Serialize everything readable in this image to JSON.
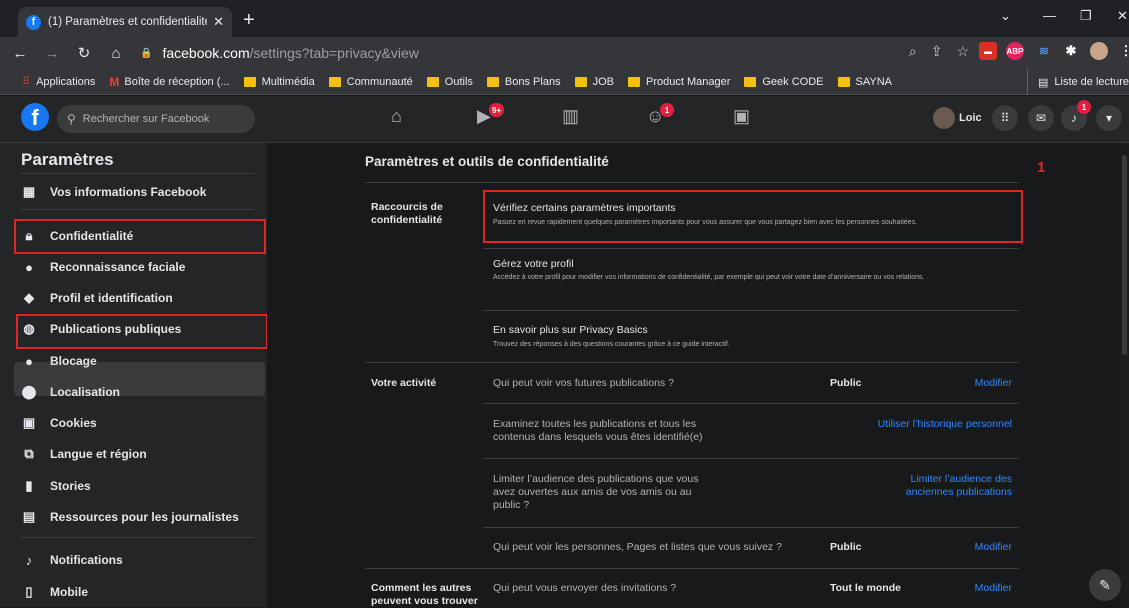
{
  "browser": {
    "tab_title": "(1) Paramètres et confidentialité |",
    "url_host": "facebook.com",
    "url_path": "/settings?tab=privacy&view",
    "bookmarks": [
      "Applications",
      "Boîte de réception (...",
      "Multimédia",
      "Communauté",
      "Outils",
      "Bons Plans",
      "JOB",
      "Product Manager",
      "Geek CODE",
      "SAYNA"
    ],
    "reading_list": "Liste de lecture",
    "ext_abp": "ABP"
  },
  "fb": {
    "search_placeholder": "Rechercher sur Facebook",
    "user_name": "Loic",
    "badge_watch": "9+",
    "badge_groups": "1",
    "badge_notif": "1"
  },
  "sidebar": {
    "title": "Paramètres",
    "items": [
      {
        "label": "Vos informations Facebook",
        "icon": "grid-icon"
      },
      {
        "label": "Confidentialité",
        "icon": "lock-icon"
      },
      {
        "label": "Reconnaissance faciale",
        "icon": "face-icon"
      },
      {
        "label": "Profil et identification",
        "icon": "tag-icon"
      },
      {
        "label": "Publications publiques",
        "icon": "globe-icon"
      },
      {
        "label": "Blocage",
        "icon": "block-user-icon"
      },
      {
        "label": "Localisation",
        "icon": "location-icon"
      },
      {
        "label": "Cookies",
        "icon": "cookie-icon"
      },
      {
        "label": "Langue et région",
        "icon": "language-icon"
      },
      {
        "label": "Stories",
        "icon": "stories-icon"
      },
      {
        "label": "Ressources pour les journalistes",
        "icon": "newspaper-icon"
      },
      {
        "label": "Notifications",
        "icon": "bell-icon"
      },
      {
        "label": "Mobile",
        "icon": "mobile-icon"
      }
    ]
  },
  "main": {
    "title": "Paramètres et outils de confidentialité",
    "annotation": "1",
    "shortcuts_label": "Raccourcis de confidentialité",
    "shortcuts": [
      {
        "title": "Vérifiez certains paramètres importants",
        "sub": "Passez en revue rapidement quelques paramètres importants pour vous assurer que vous partagez bien avec les personnes souhaitées."
      },
      {
        "title": "Gérez votre profil",
        "sub": "Accédez à votre profil pour modifier vos informations de confidentialité, par exemple qui peut voir votre date d’anniversaire ou vos relations."
      },
      {
        "title": "En savoir plus sur Privacy Basics",
        "sub": "Trouvez des réponses à des questions courantes grâce à ce guide interactif."
      }
    ],
    "activity_label": "Votre activité",
    "activity": [
      {
        "text": "Qui peut voir vos futures publications ?",
        "value": "Public",
        "link": "Modifier"
      },
      {
        "text": "Examinez toutes les publications et tous les contenus dans lesquels vous êtes identifié(e)",
        "value": "",
        "link": "Utiliser l’historique personnel"
      },
      {
        "text": "Limiter l’audience des publications que vous avez ouvertes aux amis de vos amis ou au public ?",
        "value": "",
        "link": "Limiter l’audience des anciennes publications"
      },
      {
        "text": "Qui peut voir les personnes, Pages et listes que vous suivez ?",
        "value": "Public",
        "link": "Modifier"
      }
    ],
    "find_label": "Comment les autres peuvent vous trouver",
    "find": [
      {
        "text": "Qui peut vous envoyer des invitations ?",
        "value": "Tout le monde",
        "link": "Modifier"
      }
    ]
  }
}
